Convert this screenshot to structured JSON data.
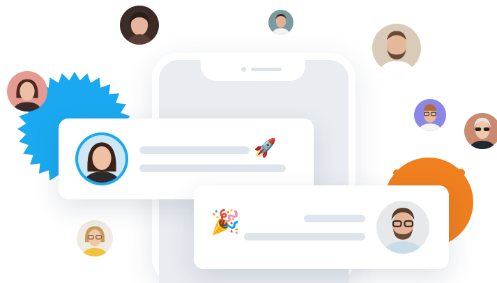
{
  "colors": {
    "accent_blue": "#1aa9f0",
    "accent_orange": "#f07f1f",
    "placeholder_line": "#dfe5ec",
    "phone_screen": "#e9edf2"
  },
  "icons": {
    "rocket": "rocket-icon",
    "party_popper": "party-popper-icon"
  }
}
